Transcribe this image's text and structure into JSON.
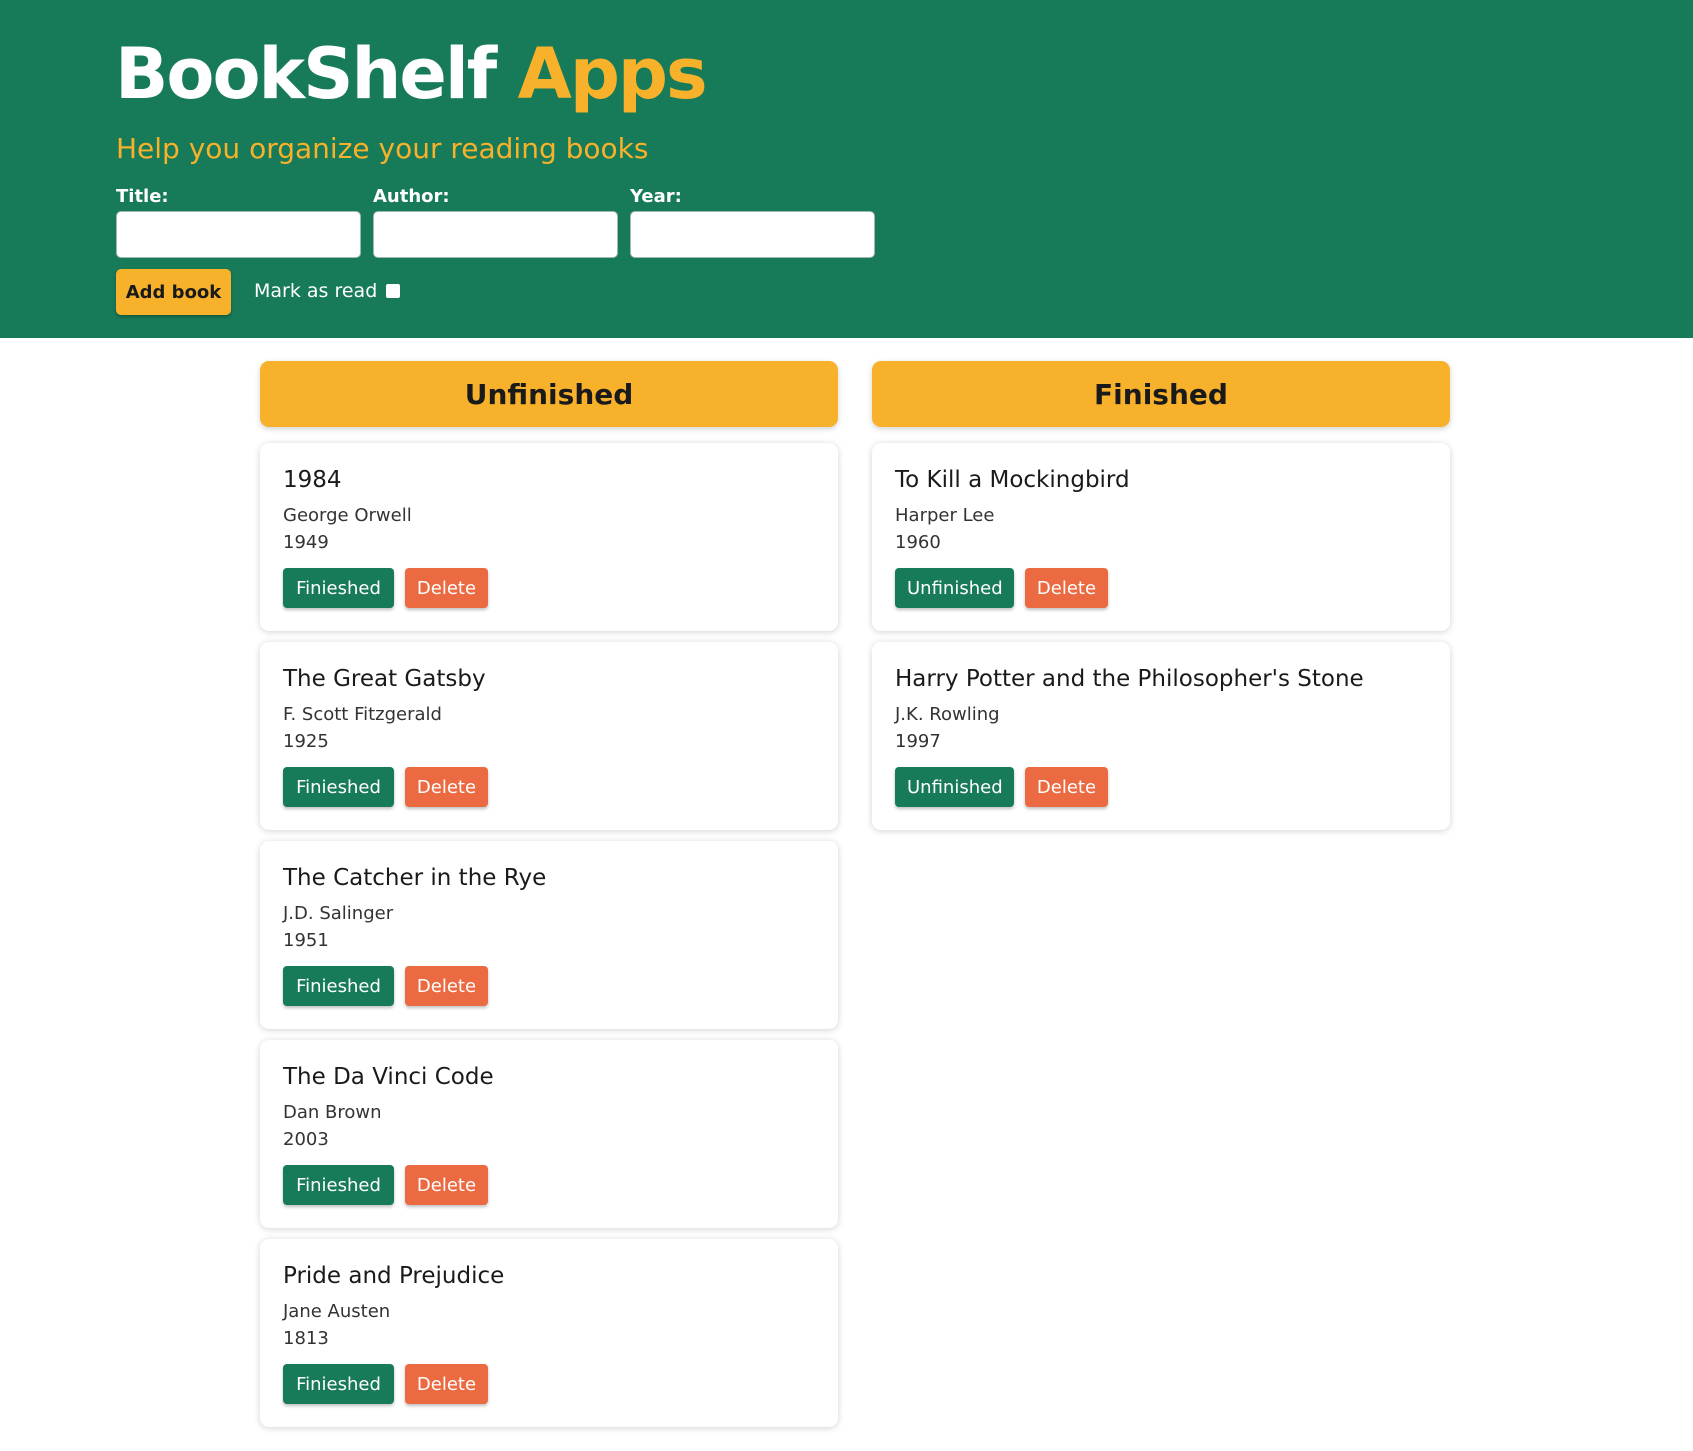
{
  "header": {
    "title_main": "BookShelf",
    "title_accent": "Apps",
    "subtitle": "Help you organize your reading books"
  },
  "form": {
    "title_label": "Title:",
    "author_label": "Author:",
    "year_label": "Year:",
    "title_value": "",
    "author_value": "",
    "year_value": "",
    "add_button": "Add book",
    "mark_read_label": "Mark as read",
    "mark_read_checked": false
  },
  "columns": {
    "unfinished_heading": "Unfinished",
    "finished_heading": "Finished"
  },
  "unfinished": [
    {
      "title": "1984",
      "author": "George Orwell",
      "year": "1949",
      "move_label": "Finieshed",
      "delete_label": "Delete"
    },
    {
      "title": "The Great Gatsby",
      "author": "F. Scott Fitzgerald",
      "year": "1925",
      "move_label": "Finieshed",
      "delete_label": "Delete"
    },
    {
      "title": "The Catcher in the Rye",
      "author": "J.D. Salinger",
      "year": "1951",
      "move_label": "Finieshed",
      "delete_label": "Delete"
    },
    {
      "title": "The Da Vinci Code",
      "author": "Dan Brown",
      "year": "2003",
      "move_label": "Finieshed",
      "delete_label": "Delete"
    },
    {
      "title": "Pride and Prejudice",
      "author": "Jane Austen",
      "year": "1813",
      "move_label": "Finieshed",
      "delete_label": "Delete"
    }
  ],
  "finished": [
    {
      "title": "To Kill a Mockingbird",
      "author": "Harper Lee",
      "year": "1960",
      "move_label": "Unfinished",
      "delete_label": "Delete"
    },
    {
      "title": "Harry Potter and the Philosopher's Stone",
      "author": "J.K. Rowling",
      "year": "1997",
      "move_label": "Unfinished",
      "delete_label": "Delete"
    }
  ],
  "colors": {
    "header_bg": "#177a58",
    "accent": "#f7b12a",
    "primary_button": "#177a58",
    "delete_button": "#ec6a42"
  }
}
